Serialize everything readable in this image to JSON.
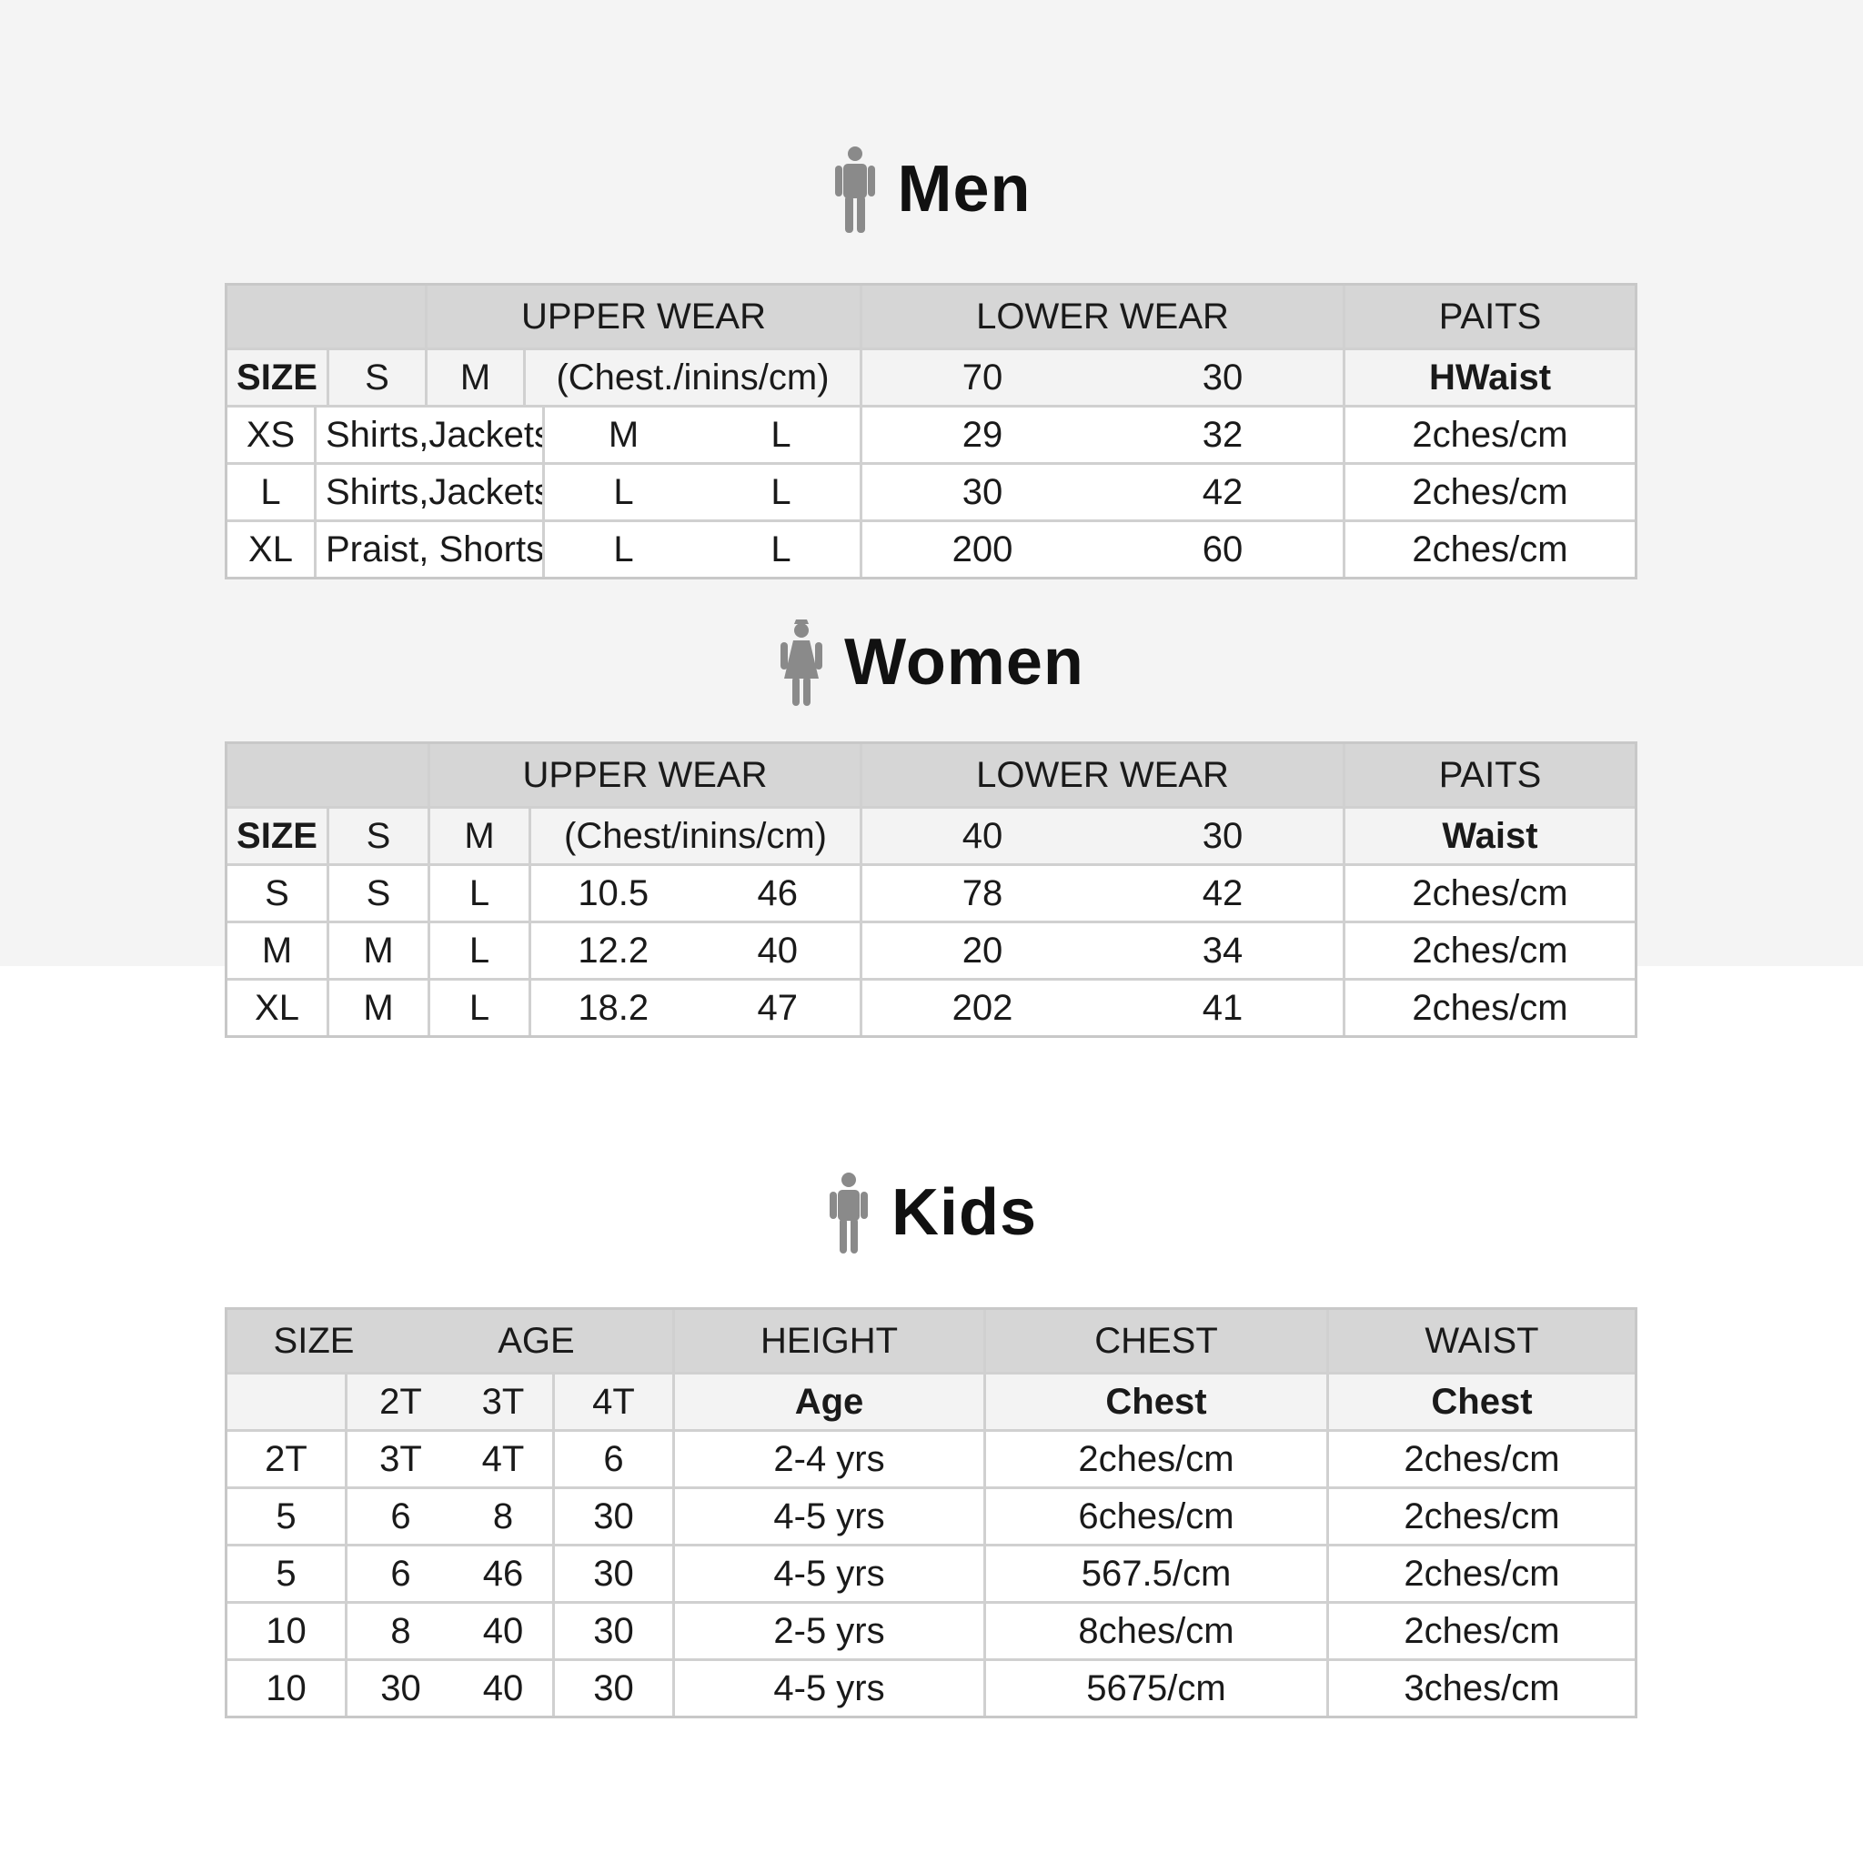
{
  "colors": {
    "page_top": "#f4f4f4",
    "header_fill": "#d6d6d6",
    "grid_line": "#d0d0d0",
    "icon": "#8a8a8a"
  },
  "men": {
    "title": "Men",
    "icon": "man-figure-icon",
    "head": {
      "upper": "UPPER WEAR",
      "lower": "LOWER WEAR",
      "paits": "PAITS"
    },
    "sub": {
      "size": "SIZE",
      "s": "S",
      "m": "M",
      "chest": "(Chest./inins/cm)",
      "l1": "70",
      "l2": "30",
      "waist": "HWaist"
    },
    "rows": [
      {
        "size": "XS",
        "type": "Shirts,Jackets",
        "u1": "M",
        "u2": "L",
        "l1": "29",
        "l2": "32",
        "p": "2ches/cm"
      },
      {
        "size": "L",
        "type": "Shirts,Jackets",
        "u1": "L",
        "u2": "L",
        "l1": "30",
        "l2": "42",
        "p": "2ches/cm"
      },
      {
        "size": "XL",
        "type": "Praist, Shorts",
        "u1": "L",
        "u2": "L",
        "l1": "200",
        "l2": "60",
        "p": "2ches/cm"
      }
    ]
  },
  "women": {
    "title": "Women",
    "icon": "woman-figure-icon",
    "head": {
      "upper": "UPPER WEAR",
      "lower": "LOWER WEAR",
      "paits": "PAITS"
    },
    "sub": {
      "size": "SIZE",
      "s": "S",
      "m": "M",
      "chest": "(Chest/inins/cm)",
      "l1": "40",
      "l2": "30",
      "waist": "Waist"
    },
    "rows": [
      {
        "c1": "S",
        "c2": "S",
        "c3": "L",
        "u1": "10.5",
        "u2": "46",
        "l1": "78",
        "l2": "42",
        "p": "2ches/cm"
      },
      {
        "c1": "M",
        "c2": "M",
        "c3": "L",
        "u1": "12.2",
        "u2": "40",
        "l1": "20",
        "l2": "34",
        "p": "2ches/cm"
      },
      {
        "c1": "XL",
        "c2": "M",
        "c3": "L",
        "u1": "18.2",
        "u2": "47",
        "l1": "202",
        "l2": "41",
        "p": "2ches/cm"
      }
    ]
  },
  "kids": {
    "title": "Kids",
    "icon": "child-figure-icon",
    "head": {
      "size": "SIZE",
      "age": "AGE",
      "height": "HEIGHT",
      "chest": "CHEST",
      "waist": "WAIST"
    },
    "sub": {
      "a1": "2T",
      "a2": "3T",
      "a3": "4T",
      "height": "Age",
      "chest": "Chest",
      "waist": "Chest"
    },
    "rows": [
      {
        "c1": "2T",
        "c2": "3T",
        "c3": "4T",
        "c4": "6",
        "h": "2-4 yrs",
        "ch": "2ches/cm",
        "w": "2ches/cm"
      },
      {
        "c1": "5",
        "c2": "6",
        "c3": "8",
        "c4": "30",
        "h": "4-5 yrs",
        "ch": "6ches/cm",
        "w": "2ches/cm"
      },
      {
        "c1": "5",
        "c2": "6",
        "c3": "46",
        "c4": "30",
        "h": "4-5 yrs",
        "ch": "567.5/cm",
        "w": "2ches/cm"
      },
      {
        "c1": "10",
        "c2": "8",
        "c3": "40",
        "c4": "30",
        "h": "2-5 yrs",
        "ch": "8ches/cm",
        "w": "2ches/cm"
      },
      {
        "c1": "10",
        "c2": "30",
        "c3": "40",
        "c4": "30",
        "h": "4-5 yrs",
        "ch": "5675/cm",
        "w": "3ches/cm"
      }
    ]
  }
}
